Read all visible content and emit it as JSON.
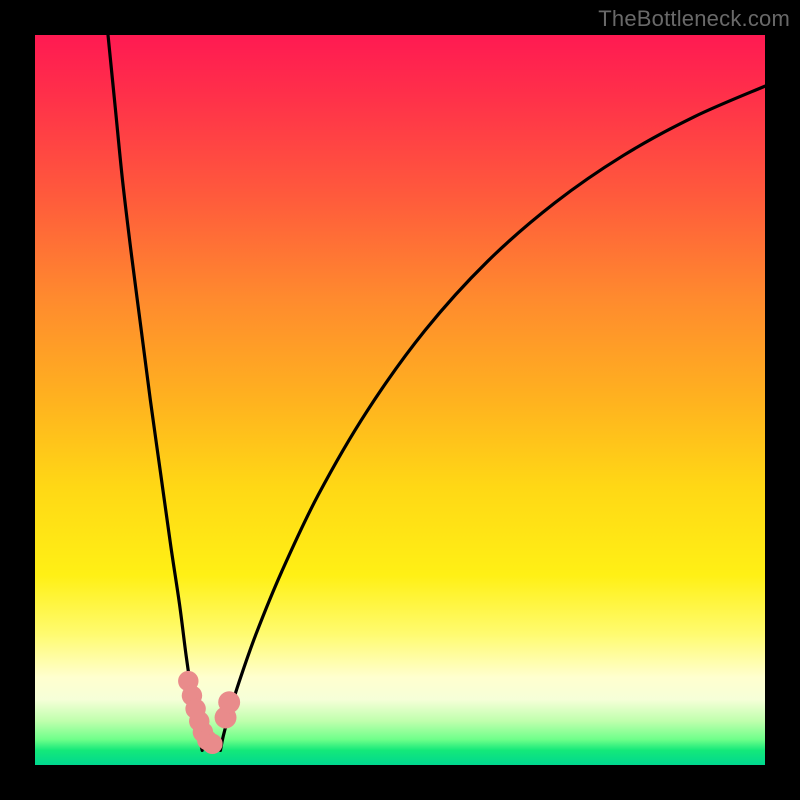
{
  "watermark": "TheBottleneck.com",
  "colors": {
    "gradient_top": "#ff1a52",
    "gradient_mid": "#ffd815",
    "gradient_bottom": "#00d88f",
    "curve": "#000000",
    "marker": "#e98b8b",
    "frame": "#000000"
  },
  "chart_data": {
    "type": "line",
    "title": "",
    "xlabel": "",
    "ylabel": "",
    "xlim": [
      0,
      100
    ],
    "ylim": [
      0,
      100
    ],
    "note": "x,y in percent of plot area from top-left; two branches of a V-shaped bottleneck curve meeting near bottom; rounded markers cluster at the valley",
    "series": [
      {
        "name": "left_branch",
        "x": [
          10.0,
          11.0,
          12.0,
          13.2,
          14.5,
          15.8,
          17.2,
          18.6,
          19.8,
          20.7,
          21.5,
          22.1,
          22.6,
          22.9
        ],
        "y": [
          0.0,
          10.0,
          20.0,
          30.0,
          40.0,
          50.0,
          60.0,
          70.0,
          78.0,
          85.0,
          90.5,
          94.0,
          96.5,
          98.0
        ]
      },
      {
        "name": "right_branch",
        "x": [
          25.4,
          25.8,
          26.6,
          28.0,
          30.3,
          33.8,
          38.8,
          45.5,
          53.4,
          62.0,
          71.2,
          80.6,
          90.3,
          100.0
        ],
        "y": [
          98.0,
          96.0,
          93.0,
          88.5,
          82.0,
          73.5,
          63.0,
          51.5,
          40.5,
          31.0,
          23.0,
          16.5,
          11.2,
          7.0
        ]
      }
    ],
    "markers": [
      {
        "x": 21.0,
        "y": 88.5,
        "r": 1.4
      },
      {
        "x": 21.5,
        "y": 90.5,
        "r": 1.4
      },
      {
        "x": 22.0,
        "y": 92.3,
        "r": 1.4
      },
      {
        "x": 22.5,
        "y": 94.0,
        "r": 1.4
      },
      {
        "x": 23.0,
        "y": 95.5,
        "r": 1.4
      },
      {
        "x": 23.6,
        "y": 96.6,
        "r": 1.4
      },
      {
        "x": 24.3,
        "y": 97.1,
        "r": 1.4
      },
      {
        "x": 26.1,
        "y": 93.5,
        "r": 1.5
      },
      {
        "x": 26.6,
        "y": 91.4,
        "r": 1.5
      }
    ]
  }
}
